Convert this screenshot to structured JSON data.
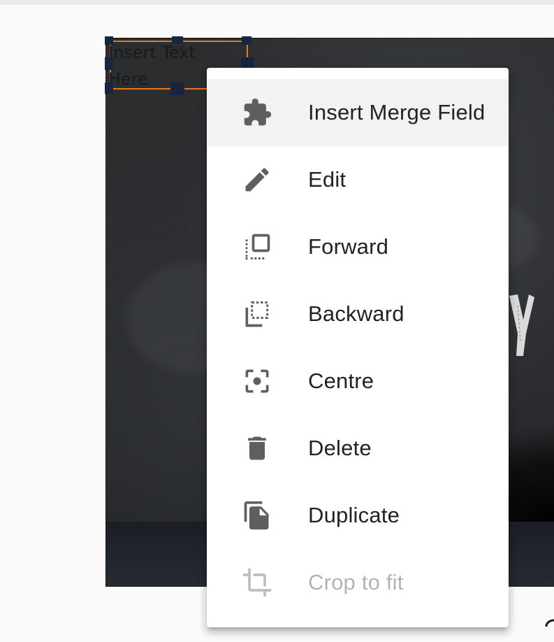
{
  "text_box": {
    "content": "Insert Text\nHere"
  },
  "context_menu": {
    "items": [
      {
        "label": "Insert Merge Field",
        "icon": "puzzle-icon",
        "state": "hover"
      },
      {
        "label": "Edit",
        "icon": "pencil-icon",
        "state": "enabled"
      },
      {
        "label": "Forward",
        "icon": "bring-forward-icon",
        "state": "enabled"
      },
      {
        "label": "Backward",
        "icon": "send-backward-icon",
        "state": "enabled"
      },
      {
        "label": "Centre",
        "icon": "center-focus-icon",
        "state": "enabled"
      },
      {
        "label": "Delete",
        "icon": "trash-icon",
        "state": "enabled"
      },
      {
        "label": "Duplicate",
        "icon": "duplicate-icon",
        "state": "enabled"
      },
      {
        "label": "Crop to fit",
        "icon": "crop-icon",
        "state": "disabled"
      }
    ]
  },
  "colors": {
    "selection_border": "#e87722",
    "handle": "#17263e",
    "icon": "#5f5f5f",
    "icon_disabled": "#bdbdbd",
    "menu_hover": "#f2f2f2"
  }
}
